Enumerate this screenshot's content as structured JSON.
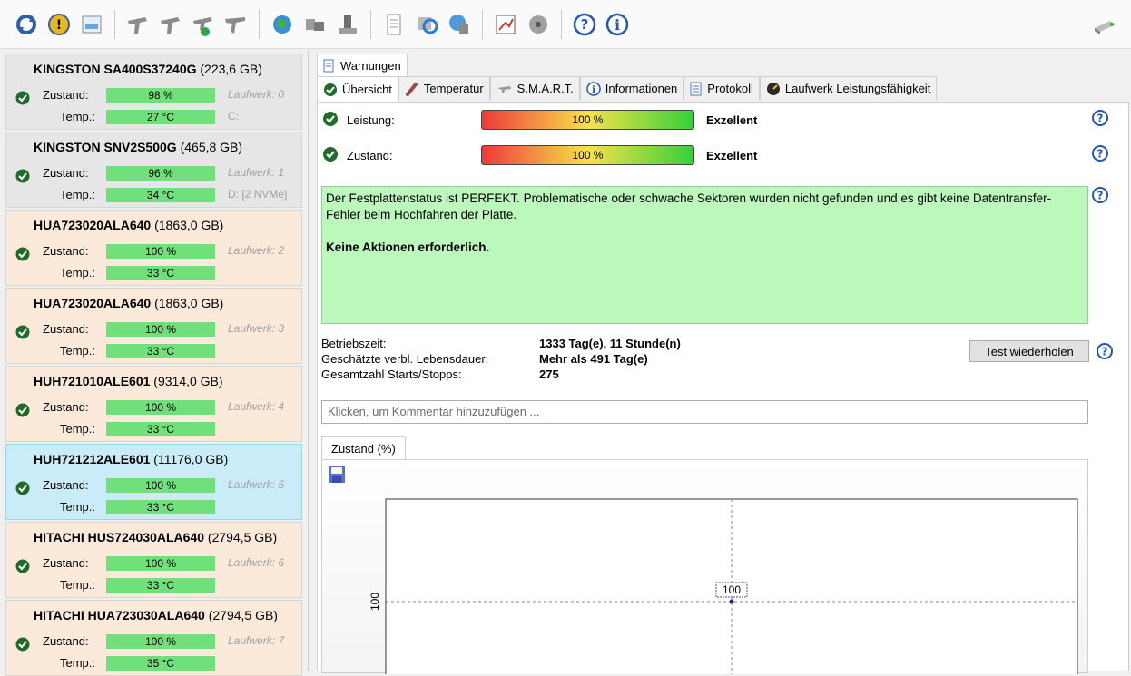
{
  "toolbar": {
    "icons": [
      "refresh-icon",
      "warning-icon",
      "drive-image-icon",
      "hand-icon",
      "hand-icon",
      "hand-check-icon",
      "hand-point-icon",
      "globe-icon",
      "drives-icon",
      "drive-tool-icon",
      "document-icon",
      "sync-icon",
      "network-icon",
      "chart-edit-icon",
      "disk-icon",
      "help-icon",
      "info-icon",
      "drive-icon"
    ]
  },
  "drives": [
    {
      "model": "KINGSTON SA400S37240G",
      "size": "(223,6 GB)",
      "zustand_label": "Zustand:",
      "temp_label": "Temp.:",
      "zustand": "98 %",
      "temp": "27 °C",
      "laufwerk": "Laufwerk: 0",
      "letter": "C:"
    },
    {
      "model": "KINGSTON SNV2S500G",
      "size": "(465,8 GB)",
      "zustand_label": "Zustand:",
      "temp_label": "Temp.:",
      "zustand": "96 %",
      "temp": "34 °C",
      "laufwerk": "Laufwerk: 1",
      "letter": "D: [2 NVMe]"
    },
    {
      "model": "HUA723020ALA640",
      "size": "(1863,0 GB)",
      "zustand_label": "Zustand:",
      "temp_label": "Temp.:",
      "zustand": "100 %",
      "temp": "33 °C",
      "laufwerk": "Laufwerk: 2",
      "letter": ""
    },
    {
      "model": "HUA723020ALA640",
      "size": "(1863,0 GB)",
      "zustand_label": "Zustand:",
      "temp_label": "Temp.:",
      "zustand": "100 %",
      "temp": "33 °C",
      "laufwerk": "Laufwerk: 3",
      "letter": ""
    },
    {
      "model": "HUH721010ALE601",
      "size": "(9314,0 GB)",
      "zustand_label": "Zustand:",
      "temp_label": "Temp.:",
      "zustand": "100 %",
      "temp": "33 °C",
      "laufwerk": "Laufwerk: 4",
      "letter": ""
    },
    {
      "model": "HUH721212ALE601",
      "size": "(11176,0 GB)",
      "zustand_label": "Zustand:",
      "temp_label": "Temp.:",
      "zustand": "100 %",
      "temp": "33 °C",
      "laufwerk": "Laufwerk: 5",
      "letter": ""
    },
    {
      "model": "HITACHI HUS724030ALA640",
      "size": "(2794,5 GB)",
      "zustand_label": "Zustand:",
      "temp_label": "Temp.:",
      "zustand": "100 %",
      "temp": "33 °C",
      "laufwerk": "Laufwerk: 6",
      "letter": ""
    },
    {
      "model": "HITACHI HUA723030ALA640",
      "size": "(2794,5 GB)",
      "zustand_label": "Zustand:",
      "temp_label": "Temp.:",
      "zustand": "100 %",
      "temp": "35 °C",
      "laufwerk": "Laufwerk: 7",
      "letter": ""
    }
  ],
  "tabs_row1": [
    "Warnungen"
  ],
  "tabs_row2": [
    "Übersicht",
    "Temperatur",
    "S.M.A.R.T.",
    "Informationen",
    "Protokoll",
    "Laufwerk Leistungsfähigkeit"
  ],
  "overview": {
    "leistung_label": "Leistung:",
    "leistung_value": "100 %",
    "leistung_rating": "Exzellent",
    "zustand_label": "Zustand:",
    "zustand_value": "100 %",
    "zustand_rating": "Exzellent",
    "status_text": "Der Festplattenstatus ist PERFEKT. Problematische oder schwache Sektoren wurden nicht gefunden und es gibt keine Datentransfer-Fehler beim Hochfahren der Platte.",
    "status_action": "Keine Aktionen erforderlich.",
    "betriebszeit_label": "Betriebszeit:",
    "betriebszeit": "1333 Tag(e), 11 Stunde(n)",
    "lebensdauer_label": "Geschätzte verbl. Lebensdauer:",
    "lebensdauer": "Mehr als 491 Tag(e)",
    "starts_label": "Gesamtzahl Starts/Stopps:",
    "starts": "275",
    "test_button": "Test wiederholen",
    "comment_placeholder": "Klicken, um Kommentar hinzuzufügen ..."
  },
  "chart_tab": "Zustand (%)",
  "chart_data": {
    "type": "line",
    "title": "",
    "xlabel": "",
    "ylabel": "",
    "y_tick_labels": [
      "100"
    ],
    "series": [
      {
        "values": [
          100
        ]
      }
    ],
    "point_labels": [
      "100"
    ]
  }
}
